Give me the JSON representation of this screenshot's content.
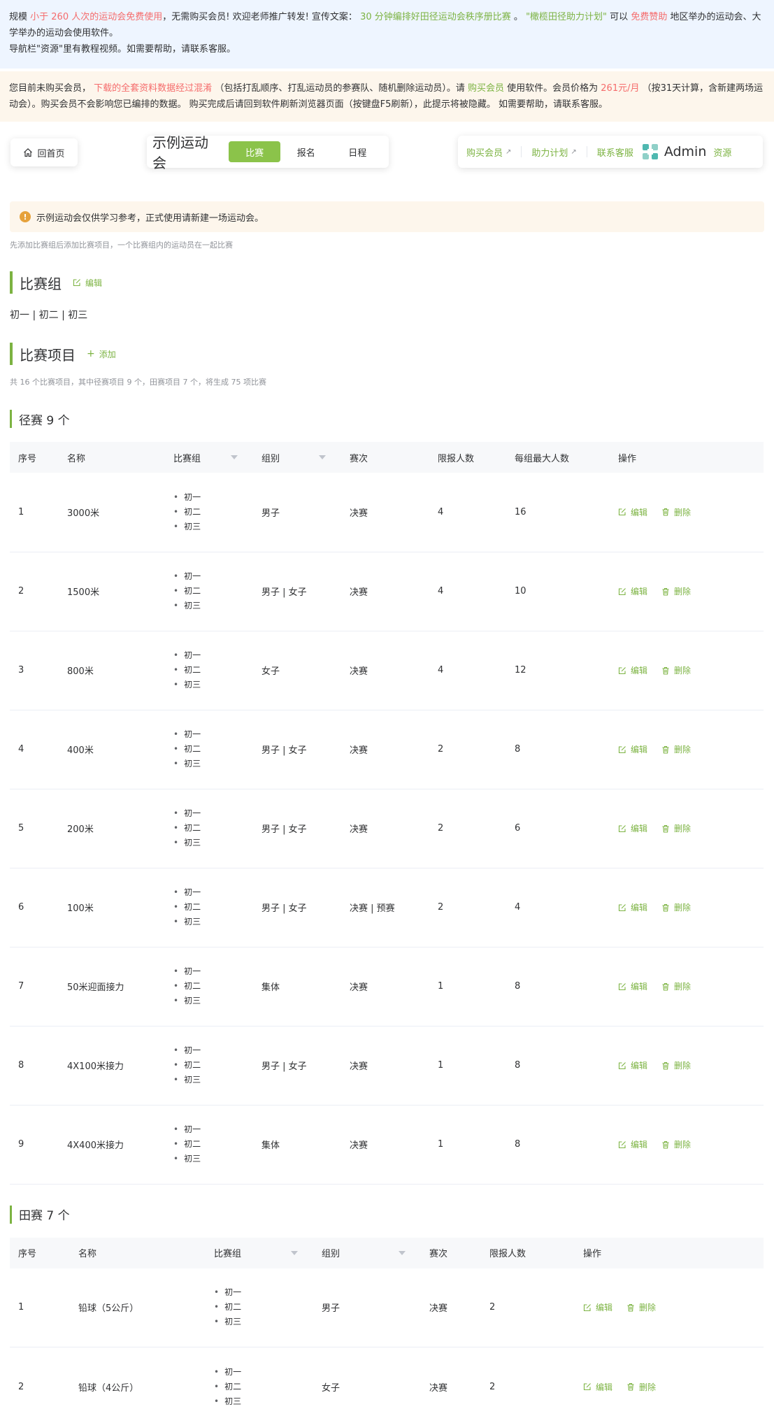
{
  "notice1": {
    "line1_a": "规模",
    "line1_b": "小于 260 人次的运动会免费使用",
    "line1_c": "，无需购买会员! 欢迎老师推广转发!  宣传文案：",
    "line1_d": "30 分钟编排好田径运动会秩序册比赛",
    "line1_e": "。",
    "line1_f": "\"橄榄田径助力计划\"",
    "line1_g": "可以",
    "line1_h": "免费赞助",
    "line1_i": "地区举办的运动会、大学举办的运动会使用软件。",
    "line3": "导航栏\"资源\"里有教程视频。如需要帮助，请联系客服。"
  },
  "notice2": {
    "a": "您目前未购买会员，",
    "b": "下载的全套资料数据经过混淆",
    "c": "（包括打乱顺序、打乱运动员的参赛队、随机删除运动员）。请",
    "d": "购买会员",
    "e": "使用软件。会员价格为",
    "f": "261元/月",
    "g": "（按31天计算，含新建两场运动会）。购买会员不会影响您已编排的数据。 购买完成后请回到软件刷新浏览器页面（按键盘F5刷新），此提示将被隐藏。 如需要帮助，请联系客服。"
  },
  "nav": {
    "home": "回首页",
    "event_name": "示例运动会",
    "tabs": [
      "比赛",
      "报名",
      "日程"
    ],
    "buy": "购买会员",
    "support": "助力计划",
    "contact": "联系客服",
    "user": "Admin",
    "resources": "资源"
  },
  "warn": "示例运动会仅供学习参考，正式使用请新建一场运动会。",
  "hint": "先添加比赛组后添加比赛项目，一个比赛组内的运动员在一起比赛",
  "groups_section": {
    "title": "比赛组",
    "action": "编辑",
    "value": "初一 | 初二 | 初三"
  },
  "events_section": {
    "title": "比赛项目",
    "action": "添加",
    "count": "共 16 个比赛项目，其中径赛项目 9 个，田赛项目 7 个，将生成 75 项比赛"
  },
  "track": {
    "title": "径赛 9 个",
    "headers": [
      "序号",
      "名称",
      "比赛组",
      "组别",
      "赛次",
      "限报人数",
      "每组最大人数",
      "操作"
    ],
    "rows": [
      {
        "no": "1",
        "name": "3000米",
        "groups": [
          "初一",
          "初二",
          "初三"
        ],
        "gender": "男子",
        "round": "决赛",
        "limit": "4",
        "max": "16"
      },
      {
        "no": "2",
        "name": "1500米",
        "groups": [
          "初一",
          "初二",
          "初三"
        ],
        "gender": "男子 | 女子",
        "round": "决赛",
        "limit": "4",
        "max": "10"
      },
      {
        "no": "3",
        "name": "800米",
        "groups": [
          "初一",
          "初二",
          "初三"
        ],
        "gender": "女子",
        "round": "决赛",
        "limit": "4",
        "max": "12"
      },
      {
        "no": "4",
        "name": "400米",
        "groups": [
          "初一",
          "初二",
          "初三"
        ],
        "gender": "男子 | 女子",
        "round": "决赛",
        "limit": "2",
        "max": "8"
      },
      {
        "no": "5",
        "name": "200米",
        "groups": [
          "初一",
          "初二",
          "初三"
        ],
        "gender": "男子 | 女子",
        "round": "决赛",
        "limit": "2",
        "max": "6"
      },
      {
        "no": "6",
        "name": "100米",
        "groups": [
          "初一",
          "初二",
          "初三"
        ],
        "gender": "男子 | 女子",
        "round": "决赛 | 预赛",
        "limit": "2",
        "max": "4"
      },
      {
        "no": "7",
        "name": "50米迎面接力",
        "groups": [
          "初一",
          "初二",
          "初三"
        ],
        "gender": "集体",
        "round": "决赛",
        "limit": "1",
        "max": "8"
      },
      {
        "no": "8",
        "name": "4X100米接力",
        "groups": [
          "初一",
          "初二",
          "初三"
        ],
        "gender": "男子 | 女子",
        "round": "决赛",
        "limit": "1",
        "max": "8"
      },
      {
        "no": "9",
        "name": "4X400米接力",
        "groups": [
          "初一",
          "初二",
          "初三"
        ],
        "gender": "集体",
        "round": "决赛",
        "limit": "1",
        "max": "8"
      }
    ]
  },
  "field": {
    "title": "田赛 7 个",
    "headers": [
      "序号",
      "名称",
      "比赛组",
      "组别",
      "赛次",
      "限报人数",
      "操作"
    ],
    "rows": [
      {
        "no": "1",
        "name": "铅球（5公斤）",
        "groups": [
          "初一",
          "初二",
          "初三"
        ],
        "gender": "男子",
        "round": "决赛",
        "limit": "2"
      },
      {
        "no": "2",
        "name": "铅球（4公斤）",
        "groups": [
          "初一",
          "初二",
          "初三"
        ],
        "gender": "女子",
        "round": "决赛",
        "limit": "2"
      }
    ]
  },
  "ops": {
    "edit": "编辑",
    "delete": "删除"
  }
}
